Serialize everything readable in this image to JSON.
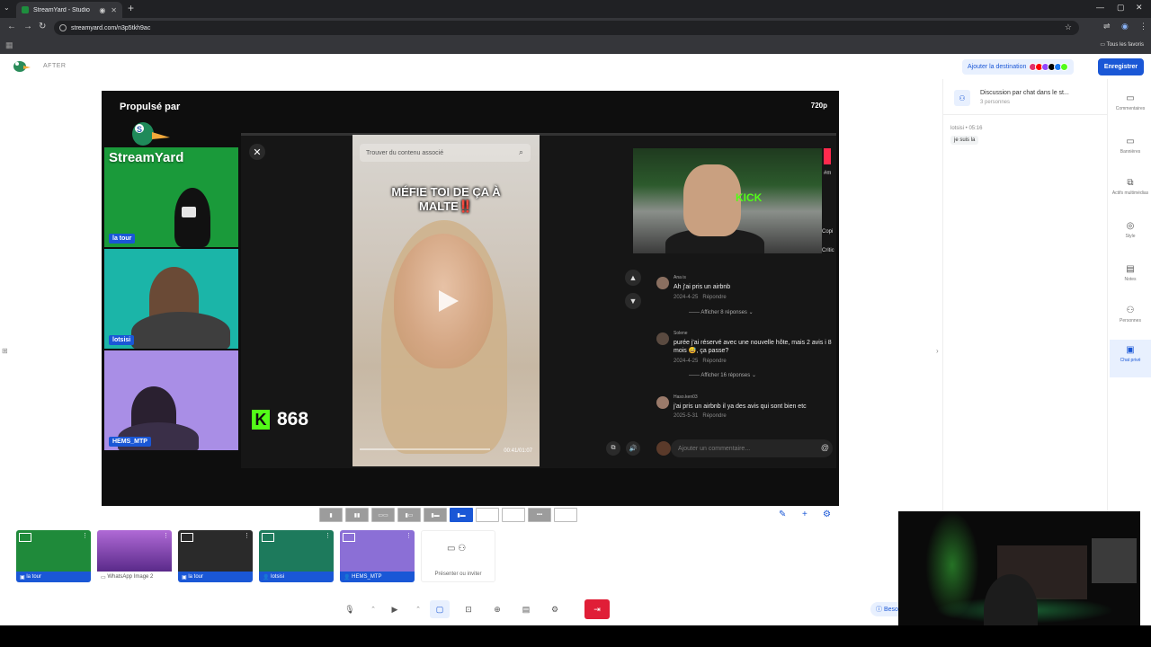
{
  "browser": {
    "tab_title": "StreamYard - Studio",
    "url": "streamyard.com/n3p5tkh9ac",
    "bookmarks_folder": "Tous les favoris"
  },
  "header": {
    "brand": "AFTER",
    "add_destination": "Ajouter la destination",
    "record": "Enregistrer",
    "dest_colors": [
      "#e1306c",
      "#ff0000",
      "#9146ff",
      "#1877f2",
      "#000000",
      "#53fc18"
    ]
  },
  "stage": {
    "powered_by": "Propulsé par",
    "resolution": "720p",
    "streamyard_overlay": "StreamYard",
    "cams": [
      {
        "name": "la tour"
      },
      {
        "name": "lotsisi"
      },
      {
        "name": "HEMS_MTP"
      }
    ],
    "share": {
      "search_placeholder": "Trouver du contenu associé",
      "caption_line1": "MÉFIE TOI DE ÇA À",
      "caption_line2": "MALTE‼️",
      "time": "00:41/01:07",
      "kick_count": "868",
      "webcam_text": "KICK",
      "side_labels": [
        "#m",
        "Copi",
        "Critic"
      ],
      "comments": [
        {
          "user": "Ana is",
          "text": "Ah j'ai pris un airbnb",
          "date": "2024-4-25",
          "reply": "Répondre",
          "replies": "Afficher 8 réponses"
        },
        {
          "user": "Solene",
          "text": "purée j'ai réservé avec une nouvelle hôte, mais 2 avis i 8 mois 😅, ça passe?",
          "date": "2024-4-25",
          "reply": "Répondre",
          "replies": "Afficher 16 réponses"
        },
        {
          "user": "Haso.ken03",
          "text": "j'ai pris un airbnb il ya des avis qui sont bien etc",
          "date": "2025-5-31",
          "reply": "Répondre"
        }
      ],
      "add_comment": "Ajouter un commentaire..."
    }
  },
  "sources": [
    {
      "label": "la tour",
      "bg": "#1f8a3a"
    },
    {
      "label": "WhatsApp Image 2",
      "bg": "#7a4bb0"
    },
    {
      "label": "la tour",
      "bg": "#2a2a2a"
    },
    {
      "label": "lotsisi",
      "bg": "#1d7a5c"
    },
    {
      "label": "HEMS_MTP",
      "bg": "#8b6fd6"
    }
  ],
  "present": {
    "label": "Présenter ou inviter"
  },
  "help": "Besoin",
  "chat": {
    "title": "Discussion par chat dans le st...",
    "subtitle": "3 personnes",
    "msg_author": "lotsisi",
    "msg_time": "05:16",
    "msg_text": "je suis la"
  },
  "side_tabs": [
    {
      "label": "Commentaires",
      "icon": "comment-icon"
    },
    {
      "label": "Bannières",
      "icon": "banner-icon"
    },
    {
      "label": "Actifs multimédias",
      "icon": "media-icon"
    },
    {
      "label": "Style",
      "icon": "palette-icon"
    },
    {
      "label": "Notes",
      "icon": "notes-icon"
    },
    {
      "label": "Personnes",
      "icon": "people-icon"
    },
    {
      "label": "Chat privé",
      "icon": "private-chat-icon"
    }
  ]
}
